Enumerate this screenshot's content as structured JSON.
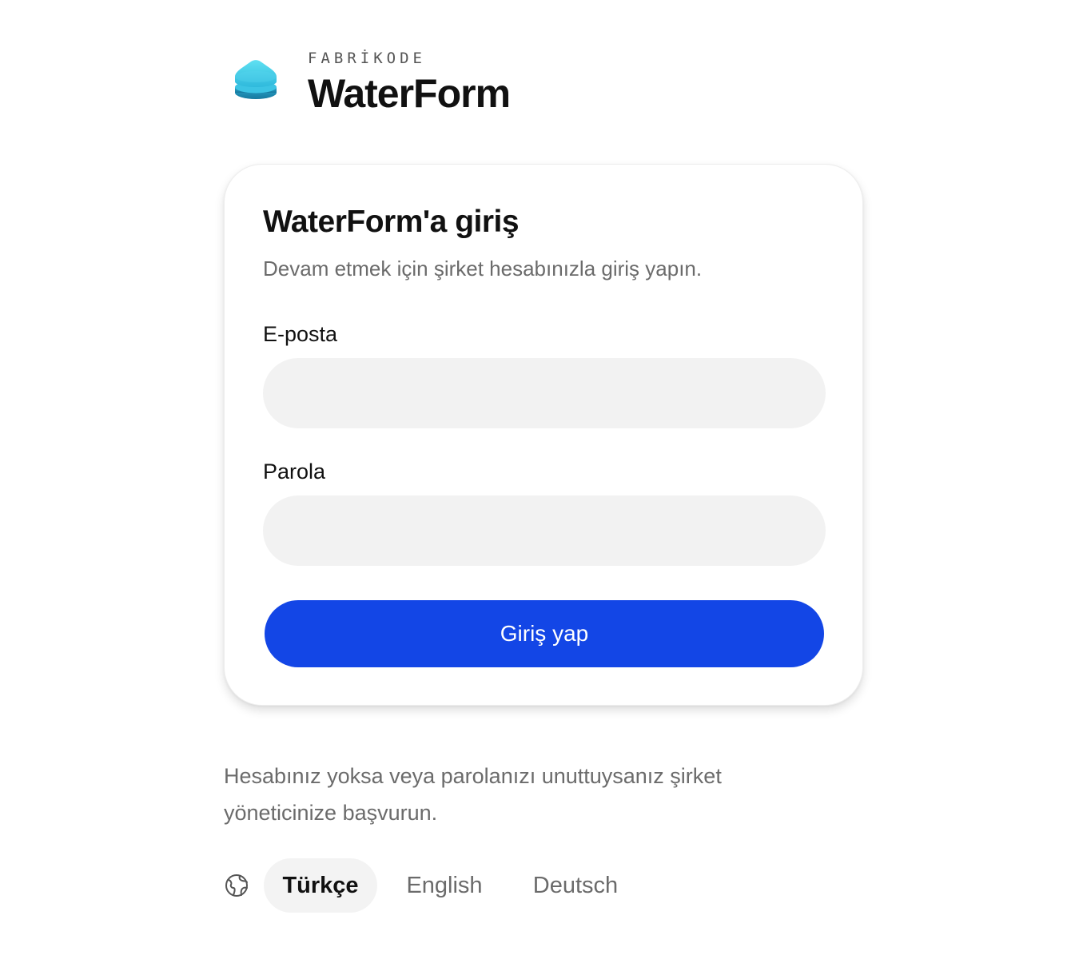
{
  "brand": {
    "logo_icon": "water-drop-stack-icon",
    "kicker": "FABRİKODE",
    "name": "WaterForm",
    "colors": {
      "logo_top": "#4fd6ee",
      "logo_bottom": "#1f8fb5"
    }
  },
  "login": {
    "title": "WaterForm'a giriş",
    "subtitle": "Devam etmek için şirket hesabınızla giriş yapın.",
    "email_label": "E-posta",
    "email_value": "",
    "password_label": "Parola",
    "password_value": "",
    "submit_label": "Giriş yap",
    "accent_color": "#1346e6"
  },
  "footer": {
    "help_text": "Hesabınız yoksa veya parolanızı unuttuysanız şirket yöneticinize başvurun.",
    "language_icon": "globe-icon",
    "languages": [
      {
        "label": "Türkçe",
        "selected": true
      },
      {
        "label": "English",
        "selected": false
      },
      {
        "label": "Deutsch",
        "selected": false
      }
    ]
  }
}
